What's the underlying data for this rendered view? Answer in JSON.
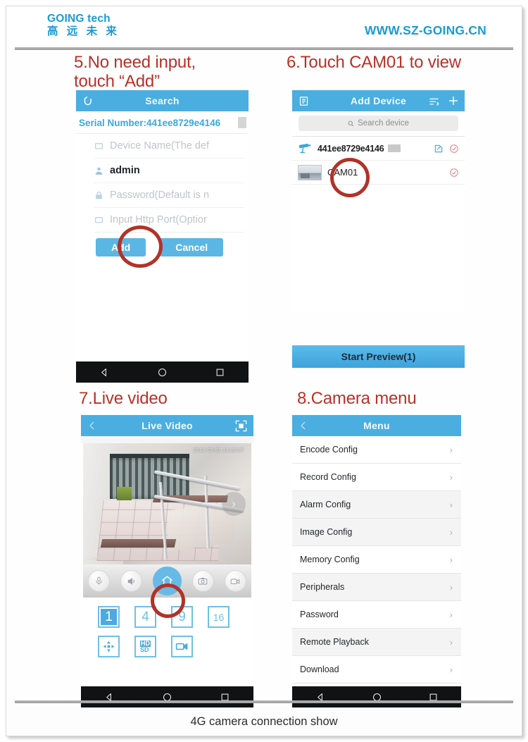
{
  "header": {
    "brand_en": "GOING tech",
    "brand_cn": "高 远 未 来",
    "url": "WWW.SZ-GOING.CN"
  },
  "footer": {
    "caption": "4G camera connection show"
  },
  "colors": {
    "brand_blue": "#1b9ad6",
    "appbar_blue": "#4aaee0",
    "annotation_red": "#b23228",
    "caption_red": "#b93127",
    "accent_button": "#5cb6e4"
  },
  "steps": [
    {
      "id": 5,
      "caption": "5.No need input,\ntouch “Add”"
    },
    {
      "id": 6,
      "caption": "6.Touch CAM01 to view"
    },
    {
      "id": 7,
      "caption": "7.Live video"
    },
    {
      "id": 8,
      "caption": "8.Camera menu"
    }
  ],
  "panel5": {
    "appbar": {
      "title": "Search",
      "back_icon": "back-arrow-icon"
    },
    "serial_label": "Serial Number:441ee8729e4146",
    "fields": [
      {
        "icon": "device-icon",
        "text": "Device Name(The def",
        "filled": false
      },
      {
        "icon": "user-icon",
        "text": "admin",
        "filled": true
      },
      {
        "icon": "lock-icon",
        "text": "Password(Default is n",
        "filled": false
      },
      {
        "icon": "port-icon",
        "text": "Input Http Port(Optior",
        "filled": false
      }
    ],
    "buttons": {
      "add": "Add",
      "cancel": "Cancel"
    },
    "navbar": [
      "back-triangle-icon",
      "home-circle-icon",
      "recents-square-icon"
    ]
  },
  "panel6": {
    "appbar": {
      "title": "Add Device",
      "menu_icon": "list-menu-icon",
      "sort_icon": "sort-icon",
      "add_icon": "plus-icon"
    },
    "search_placeholder": "Search device",
    "search_icon": "search-icon",
    "devices": [
      {
        "name": "441ee8729e4146",
        "icon": "cctv-camera-icon",
        "edit_icon": "edit-icon",
        "status_icon": "check-circle-icon",
        "masked": true
      },
      {
        "name": "CAM01",
        "icon": "snapshot-thumbnail",
        "status_icon": "check-circle-icon",
        "masked": false
      }
    ],
    "start_preview": "Start Preview(1)"
  },
  "panel7": {
    "appbar": {
      "title": "Live Video",
      "back_icon": "chevron-left-icon",
      "fullscreen_icon": "fullscreen-icon"
    },
    "video": {
      "timestamp": "2018-09-01 14:28:37",
      "watermark": "CAM01",
      "next_icon": "chevron-right-icon"
    },
    "controls": [
      {
        "name": "microphone-icon",
        "active": false
      },
      {
        "name": "speaker-icon",
        "active": false
      },
      {
        "name": "home-icon",
        "active": true
      },
      {
        "name": "snapshot-icon",
        "active": false
      },
      {
        "name": "record-icon",
        "active": false
      }
    ],
    "layout_buttons": [
      "1",
      "4",
      "9",
      "16"
    ],
    "tool_buttons": [
      {
        "name": "ptz-icon",
        "label": ""
      },
      {
        "name": "hd-sd-icon",
        "label_top": "HD",
        "label_bottom": "SD"
      },
      {
        "name": "stream-icon",
        "label": ""
      }
    ],
    "navbar": [
      "back-triangle-icon",
      "home-circle-icon",
      "recents-square-icon"
    ]
  },
  "panel8": {
    "appbar": {
      "title": "Menu",
      "back_icon": "chevron-left-icon"
    },
    "items": [
      "Encode Config",
      "Record Config",
      "Alarm Config",
      "Image Config",
      "Memory Config",
      "Peripherals",
      "Password",
      "Remote Playback",
      "Download"
    ],
    "chevron": "›",
    "navbar": [
      "back-triangle-icon",
      "home-circle-icon",
      "recents-square-icon"
    ]
  }
}
